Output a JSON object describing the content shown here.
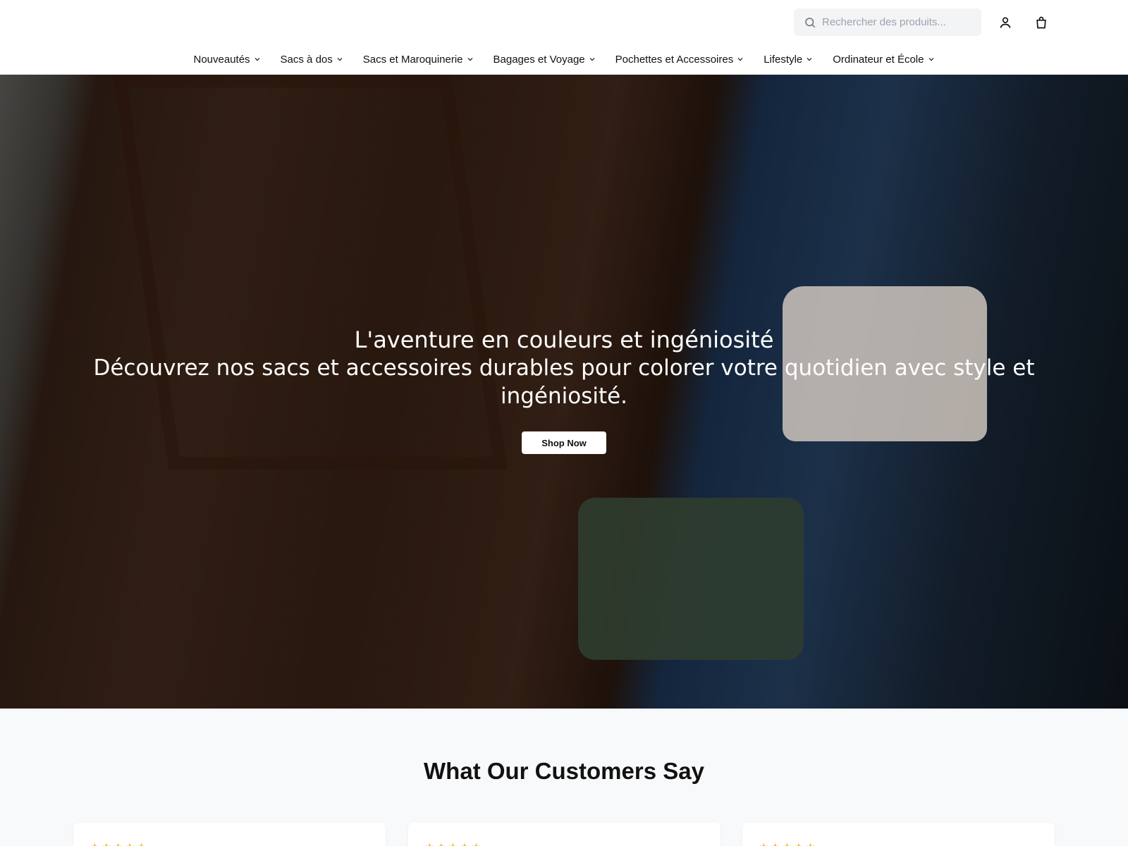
{
  "header": {
    "search": {
      "placeholder": "Rechercher des produits..."
    },
    "icons": {
      "search": "search-icon",
      "account": "user-icon",
      "cart": "shopping-bag-icon"
    }
  },
  "nav": {
    "items": [
      {
        "label": "Nouveautés"
      },
      {
        "label": "Sacs à dos"
      },
      {
        "label": "Sacs et Maroquinerie"
      },
      {
        "label": "Bagages et Voyage"
      },
      {
        "label": "Pochettes et Accessoires"
      },
      {
        "label": "Lifestyle"
      },
      {
        "label": "Ordinateur et École"
      }
    ]
  },
  "hero": {
    "title": "L'aventure en couleurs et ingéniosité",
    "subtitle": "Découvrez nos sacs et accessoires durables pour colorer votre quotidien avec style et ingéniosité.",
    "cta_label": "Shop Now"
  },
  "reviews": {
    "title": "What Our Customers Say",
    "cards": [
      {
        "stars": "★★★★★"
      },
      {
        "stars": "★★★★★"
      },
      {
        "stars": "★★★★★"
      }
    ]
  },
  "colors": {
    "accent_star": "#f5b301",
    "header_bg": "#ffffff",
    "page_bg": "#f8f9fb"
  }
}
